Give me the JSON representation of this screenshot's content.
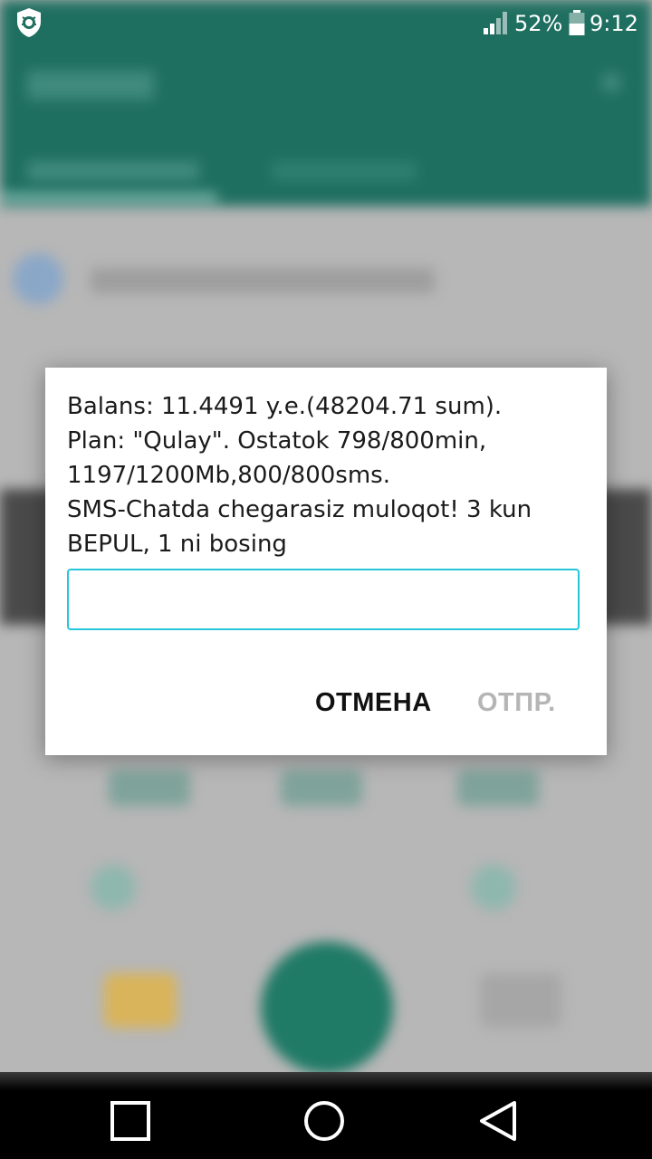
{
  "status_bar": {
    "left_icon": "shield-bug-icon",
    "signal_icon": "signal-bars-icon",
    "battery_percent": "52%",
    "battery_icon": "battery-icon",
    "battery_level": 0.52,
    "time": "9:12"
  },
  "dialog": {
    "message": "Balans: 11.4491 y.e.(48204.71 sum).\nPlan: \"Qulay\". Ostatok 798/800min,\n1197/1200Mb,800/800sms.\nSMS-Chatda chegarasiz muloqot! 3 kun\nBEPUL, 1 ni bosing",
    "input_value": "",
    "cancel_label": "ОТМЕНА",
    "send_label": "ОТПР.",
    "accent_color": "#26c6da"
  },
  "nav_bar": {
    "buttons": [
      "square-icon",
      "circle-icon",
      "triangle-back-icon"
    ]
  },
  "colors": {
    "app_bar": "#1f6f61",
    "scrim": "#b7b7b7",
    "disabled_text": "#b5b5b5"
  }
}
